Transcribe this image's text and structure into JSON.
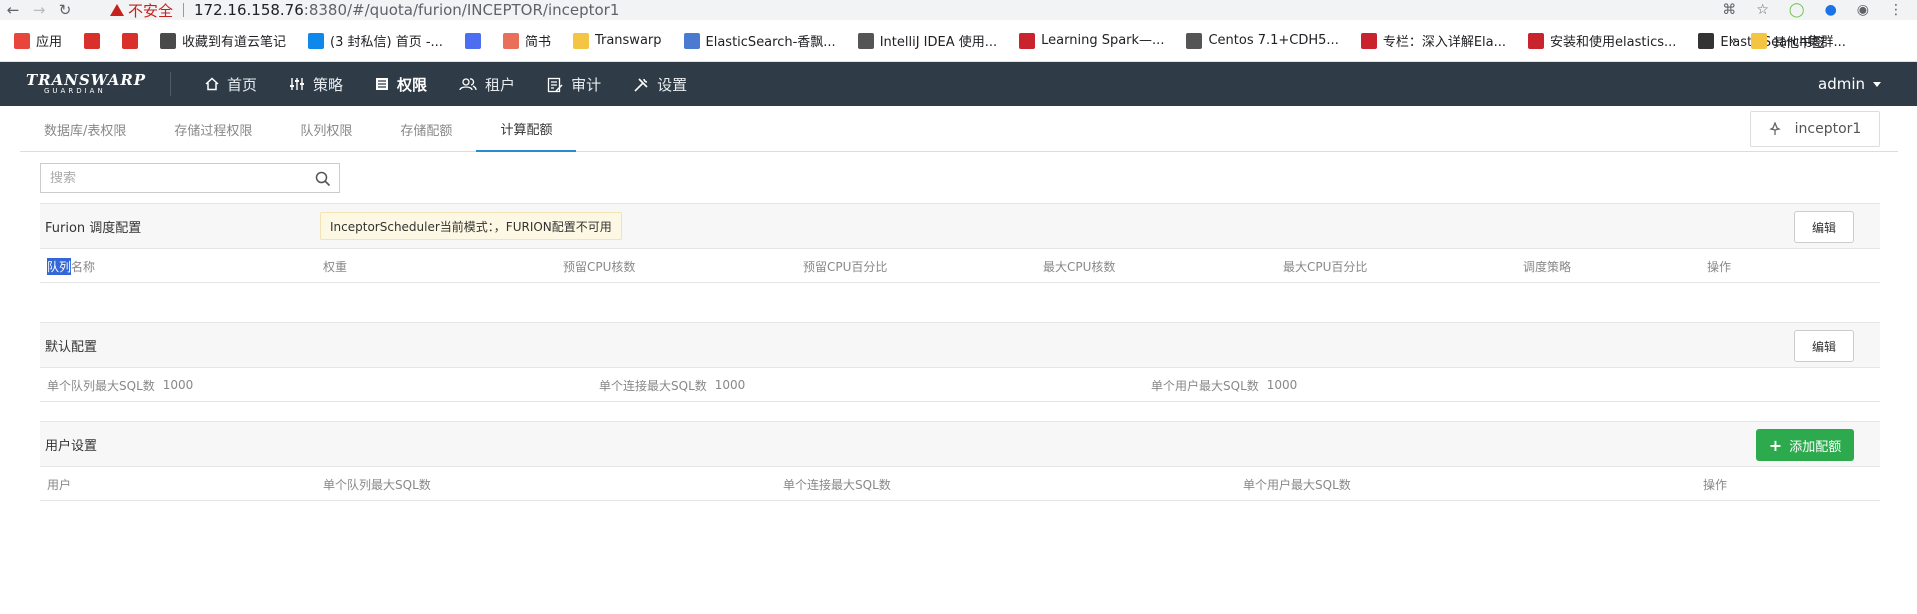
{
  "browser": {
    "insecure_label": "不安全",
    "url_host": "172.16.158.76",
    "url_rest": ":8380/#/quota/furion/INCEPTOR/inceptor1"
  },
  "bookmarks": {
    "items": [
      {
        "label": "应用",
        "icon": "apps-grid-icon",
        "color": "#e8453c"
      },
      {
        "label": "",
        "icon": "bolt-icon",
        "color": "#d9302c"
      },
      {
        "label": "",
        "icon": "bolt-icon",
        "color": "#d9302c"
      },
      {
        "label": "收藏到有道云笔记",
        "icon": "note-icon",
        "color": "#4a4a4a"
      },
      {
        "label": "(3 封私信) 首页 -...",
        "icon": "zhihu-icon",
        "color": "#0f88eb"
      },
      {
        "label": "",
        "icon": "circle-e-icon",
        "color": "#4e6ef2"
      },
      {
        "label": "简书",
        "icon": "jianshu-icon",
        "color": "#ea6f5a"
      },
      {
        "label": "Transwarp",
        "icon": "folder-icon",
        "color": "#f4c542"
      },
      {
        "label": "ElasticSearch-香飘...",
        "icon": "blog-icon",
        "color": "#4a7bd0"
      },
      {
        "label": "IntelliJ IDEA 使用...",
        "icon": "lambda-icon",
        "color": "#555555"
      },
      {
        "label": "Learning Spark—...",
        "icon": "csdn-icon",
        "color": "#c9242d"
      },
      {
        "label": "Centos 7.1+CDH5...",
        "icon": "lambda-icon",
        "color": "#555555"
      },
      {
        "label": "专栏：深入详解Ela...",
        "icon": "csdn-icon",
        "color": "#c9242d"
      },
      {
        "label": "安装和使用elastics...",
        "icon": "csdn-icon",
        "color": "#c9242d"
      },
      {
        "label": "ElasticSearch集群...",
        "icon": "linux-icon",
        "color": "#333333"
      }
    ],
    "more": "»",
    "other_folder": "其他书签"
  },
  "header": {
    "logo_line1": "TRANSWARP",
    "logo_line2": "GUARDIAN",
    "nav": [
      {
        "label": "首页",
        "icon": "home-icon"
      },
      {
        "label": "策略",
        "icon": "sliders-icon"
      },
      {
        "label": "权限",
        "icon": "list-icon",
        "active": true
      },
      {
        "label": "租户",
        "icon": "users-icon"
      },
      {
        "label": "审计",
        "icon": "audit-icon"
      },
      {
        "label": "设置",
        "icon": "tools-icon"
      }
    ],
    "user": "admin"
  },
  "subtabs": [
    {
      "label": "数据库/表权限"
    },
    {
      "label": "存储过程权限"
    },
    {
      "label": "队列权限"
    },
    {
      "label": "存储配额"
    },
    {
      "label": "计算配额",
      "active": true
    }
  ],
  "instance_button": "inceptor1",
  "search": {
    "placeholder": "搜索"
  },
  "furion": {
    "title": "Furion 调度配置",
    "notice": "InceptorScheduler当前模式：，FURION配置不可用",
    "edit": "编辑",
    "columns": [
      "队列名称",
      "权重",
      "预留CPU核数",
      "预留CPU百分比",
      "最大CPU核数",
      "最大CPU百分比",
      "调度策略",
      "操作"
    ],
    "col0_selected": "队列",
    "col0_rest": "名称"
  },
  "default_config": {
    "title": "默认配置",
    "edit": "编辑",
    "items": [
      {
        "label": "单个队列最大SQL数",
        "value": "1000"
      },
      {
        "label": "单个连接最大SQL数",
        "value": "1000"
      },
      {
        "label": "单个用户最大SQL数",
        "value": "1000"
      }
    ]
  },
  "user_settings": {
    "title": "用户设置",
    "add": "添加配额",
    "columns": [
      "用户",
      "单个队列最大SQL数",
      "单个连接最大SQL数",
      "单个用户最大SQL数",
      "操作"
    ]
  },
  "colors": {
    "header_bg": "#2f3b47",
    "active_tab": "#2a8bd1",
    "add_button": "#2eaa4e",
    "notice_bg": "#fcf8e3"
  }
}
